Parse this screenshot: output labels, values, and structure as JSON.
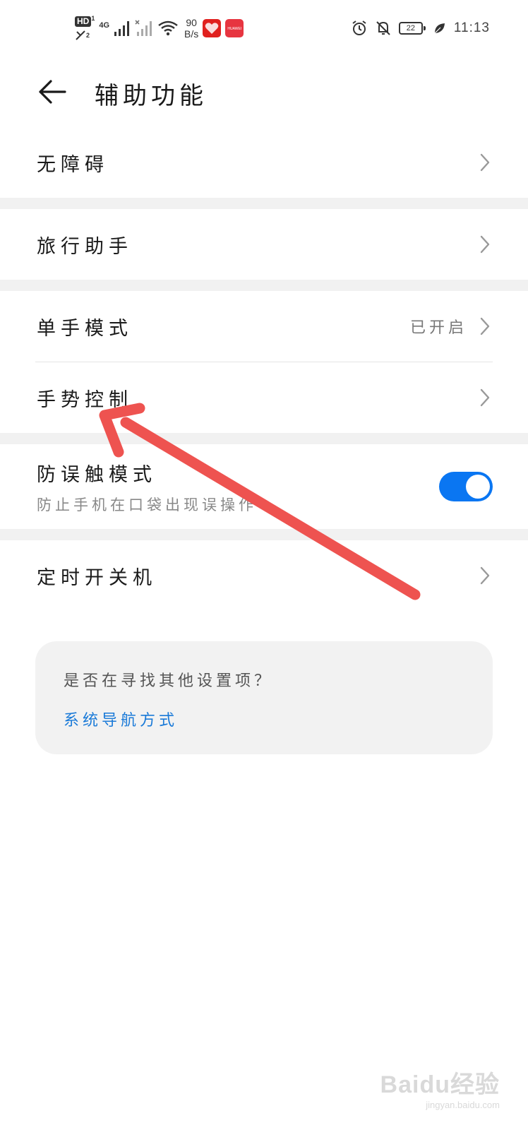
{
  "status_bar": {
    "hd_label": "HD",
    "sim1": "1",
    "sim2": "2",
    "network_type": "4G",
    "net_speed_value": "90",
    "net_speed_unit": "B/s",
    "huawei_badge": "HUAWEI",
    "battery_level": "22",
    "time": "11:13",
    "icons": [
      "signal-icon",
      "wifi-icon",
      "alarm-icon",
      "mute-icon",
      "battery-icon",
      "leaf-icon"
    ]
  },
  "header": {
    "title": "辅助功能"
  },
  "groups": [
    {
      "rows": [
        {
          "label": "无障碍"
        }
      ]
    },
    {
      "rows": [
        {
          "label": "旅行助手"
        }
      ]
    },
    {
      "rows": [
        {
          "label": "单手模式",
          "value": "已开启"
        },
        {
          "label": "手势控制"
        }
      ]
    },
    {
      "rows": [
        {
          "label": "防误触模式",
          "subtitle": "防止手机在口袋出现误操作",
          "toggle_on": true
        }
      ]
    },
    {
      "rows": [
        {
          "label": "定时开关机"
        }
      ]
    }
  ],
  "suggestion": {
    "question": "是否在寻找其他设置项？",
    "link": "系统导航方式"
  },
  "colors": {
    "accent": "#0a76f2",
    "link": "#1a7ad8",
    "annotation_arrow": "#ee5350",
    "group_gap": "#f1f1f1"
  },
  "watermark": {
    "main": "Baidu经验",
    "sub": "jingyan.baidu.com"
  }
}
